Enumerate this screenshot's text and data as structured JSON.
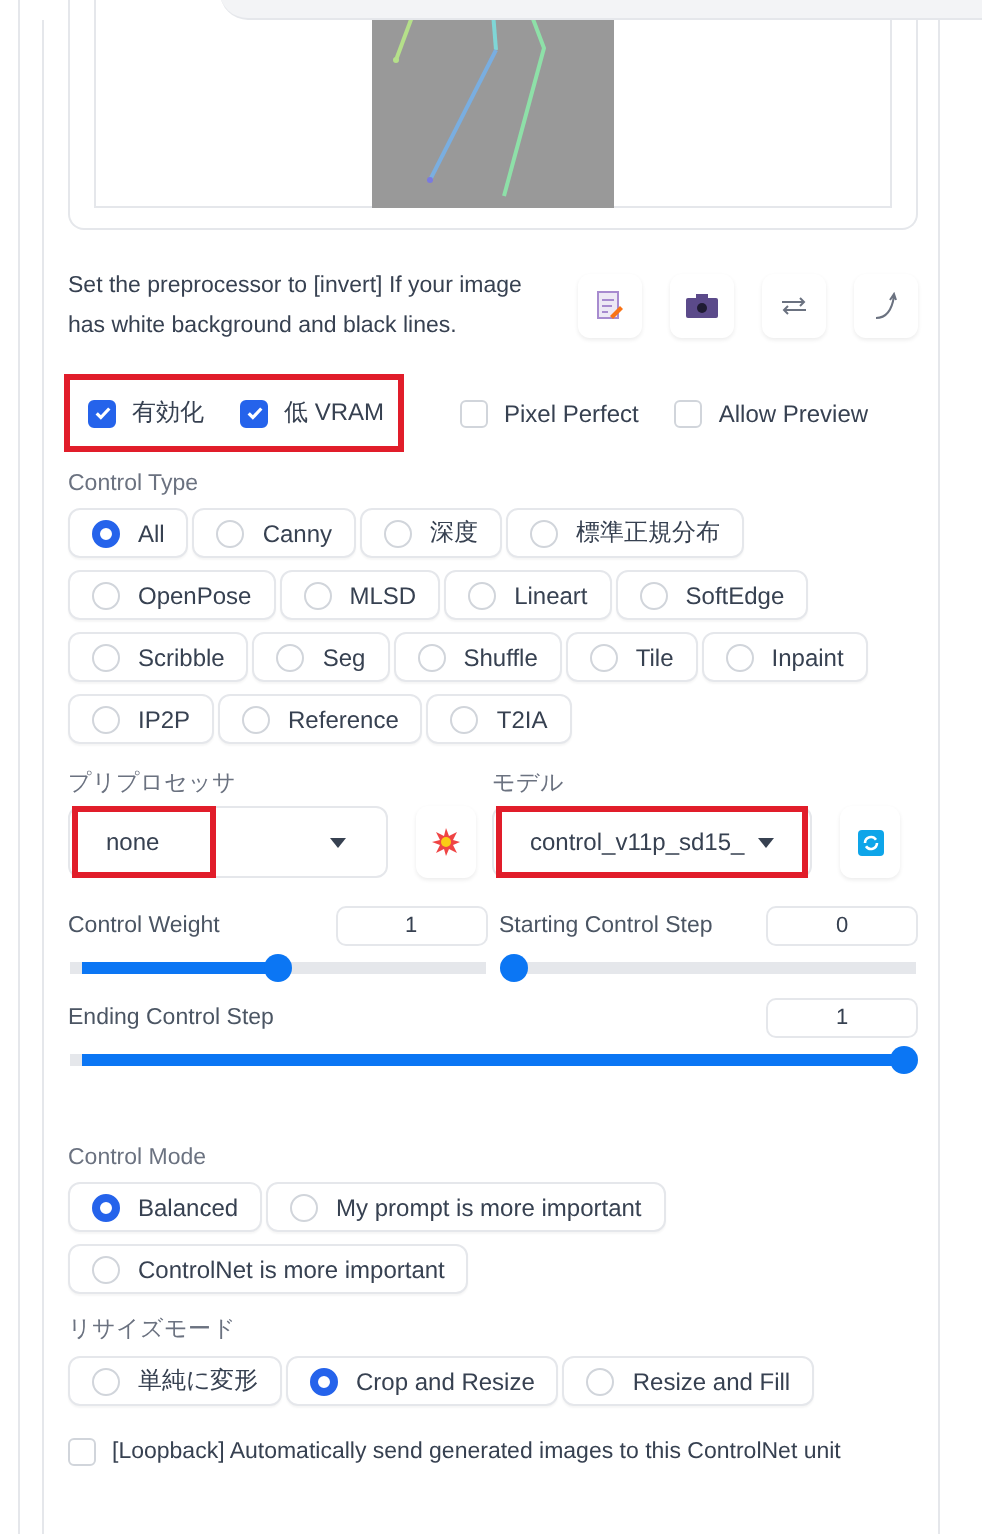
{
  "hint": "Set the preprocessor to [invert] If your image has white background and black lines.",
  "tool_buttons": [
    {
      "kind": "edit"
    },
    {
      "kind": "camera"
    },
    {
      "kind": "swap"
    },
    {
      "kind": "curve"
    }
  ],
  "option_groups": [
    {
      "highlighted": true,
      "items": [
        {
          "label": "有効化",
          "checked": true
        },
        {
          "label": "低 VRAM",
          "checked": true
        }
      ]
    },
    {
      "highlighted": false,
      "items": [
        {
          "label": "Pixel Perfect",
          "checked": false
        },
        {
          "label": "Allow Preview",
          "checked": false
        }
      ]
    }
  ],
  "control_type": {
    "label": "Control Type",
    "options": [
      {
        "label": "All",
        "selected": true
      },
      {
        "label": "Canny",
        "selected": false
      },
      {
        "label": "深度",
        "selected": false
      },
      {
        "label": "標準正規分布",
        "selected": false
      },
      {
        "label": "OpenPose",
        "selected": false
      },
      {
        "label": "MLSD",
        "selected": false
      },
      {
        "label": "Lineart",
        "selected": false
      },
      {
        "label": "SoftEdge",
        "selected": false
      },
      {
        "label": "Scribble",
        "selected": false
      },
      {
        "label": "Seg",
        "selected": false
      },
      {
        "label": "Shuffle",
        "selected": false
      },
      {
        "label": "Tile",
        "selected": false
      },
      {
        "label": "Inpaint",
        "selected": false
      },
      {
        "label": "IP2P",
        "selected": false
      },
      {
        "label": "Reference",
        "selected": false
      },
      {
        "label": "T2IA",
        "selected": false
      }
    ]
  },
  "preprocessor": {
    "label": "プリプロセッサ",
    "value": "none",
    "highlighted": true
  },
  "model": {
    "label": "モデル",
    "value": "control_v11p_sd15_",
    "highlighted": true
  },
  "sliders": [
    {
      "label": "Control Weight",
      "value": "1",
      "level": 0.5,
      "wide": false
    },
    {
      "label": "Starting Control Step",
      "value": "0",
      "level": 0,
      "wide": false
    },
    {
      "label": "Ending Control Step",
      "value": "1",
      "level": 1,
      "wide": true
    }
  ],
  "control_mode": {
    "label": "Control Mode",
    "options": [
      {
        "label": "Balanced",
        "selected": true
      },
      {
        "label": "My prompt is more important",
        "selected": false
      },
      {
        "label": "ControlNet is more important",
        "selected": false
      }
    ]
  },
  "resize_mode": {
    "label": "リサイズモード",
    "options": [
      {
        "label": "単純に変形",
        "selected": false
      },
      {
        "label": "Crop and Resize",
        "selected": true
      },
      {
        "label": "Resize and Fill",
        "selected": false
      }
    ]
  },
  "loopback": {
    "label": "[Loopback] Automatically send generated images to this ControlNet unit",
    "checked": false
  }
}
